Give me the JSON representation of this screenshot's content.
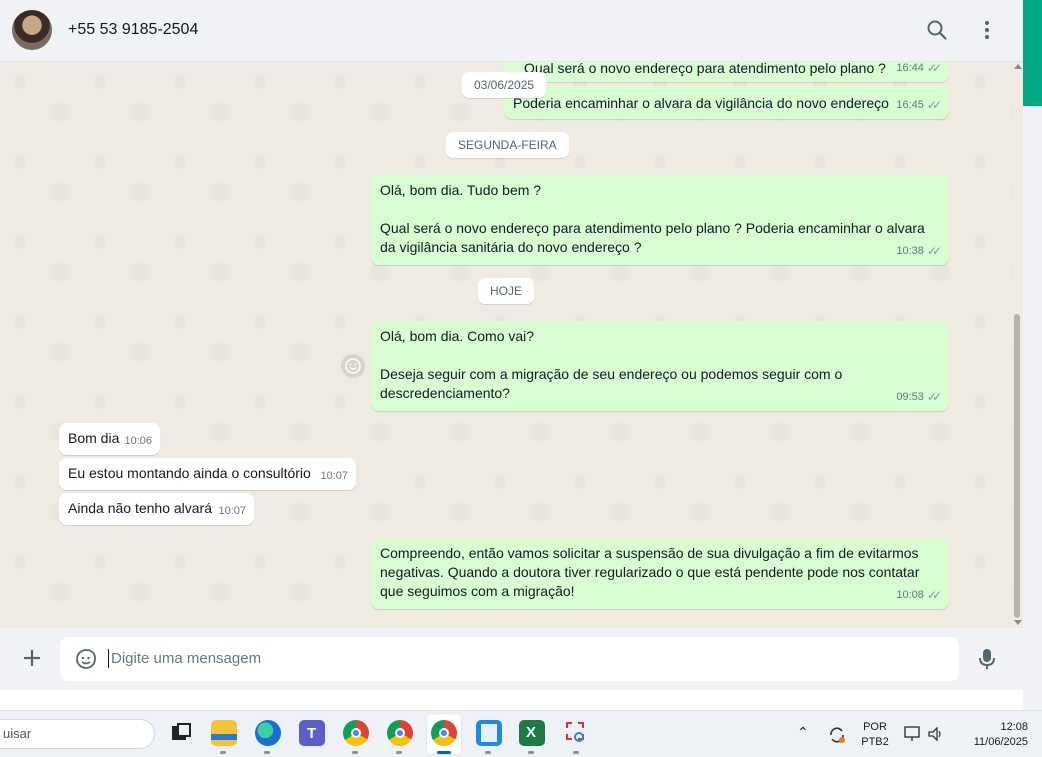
{
  "header": {
    "contact_name": "+55 53 9185-2504",
    "search_icon": "search-icon",
    "menu_icon": "kebab-menu-icon"
  },
  "messages": {
    "m1": {
      "text": "Qual será o novo endereço para atendimento pelo plano ?",
      "time": "16:44"
    },
    "date1": "03/06/2025",
    "m2": {
      "text": "Poderia encaminhar o alvara da vigilância do novo endereço",
      "time": "16:45"
    },
    "date2": "SEGUNDA-FEIRA",
    "m3": {
      "text": "Olá, bom dia. Tudo bem ?\n\nQual será o novo endereço para atendimento pelo plano ? Poderia encaminhar o alvara da vigilância sanitária do novo endereço ?",
      "time": "10:38"
    },
    "date3": "HOJE",
    "m4": {
      "text": "Olá, bom dia. Como vai?\n\nDeseja seguir com a migração de seu endereço ou podemos seguir com o descredenciamento?",
      "time": "09:53"
    },
    "m5": {
      "text": "Bom dia",
      "time": "10:06"
    },
    "m6": {
      "text": "Eu estou montando ainda o consultório",
      "time": "10:07"
    },
    "m7": {
      "text": "Ainda não tenho alvará",
      "time": "10:07"
    },
    "m8": {
      "text": "Compreendo, então vamos solicitar a suspensão de sua divulgação a fim de evitarmos negativas. Quando a doutora tiver regularizado o que está pendente pode nos contatar que seguimos com a migração!",
      "time": "10:08"
    }
  },
  "composer": {
    "placeholder": "Digite uma mensagem",
    "attach_icon": "plus-icon",
    "sticker_icon": "sticker-icon",
    "mic_icon": "microphone-icon"
  },
  "taskbar": {
    "search_text": "uisar",
    "apps": [
      "task-view",
      "file-explorer",
      "edge",
      "teams",
      "chrome",
      "chrome-profile-2",
      "chrome-active",
      "notepad",
      "excel",
      "snipping-tool"
    ],
    "lang_line1": "POR",
    "lang_line2": "PTB2",
    "time": "12:08",
    "date": "11/06/2025"
  },
  "colors": {
    "outgoing_bubble": "#d9fdd3",
    "incoming_bubble": "#ffffff",
    "wallpaper": "#efeae2",
    "accent": "#00a884"
  }
}
